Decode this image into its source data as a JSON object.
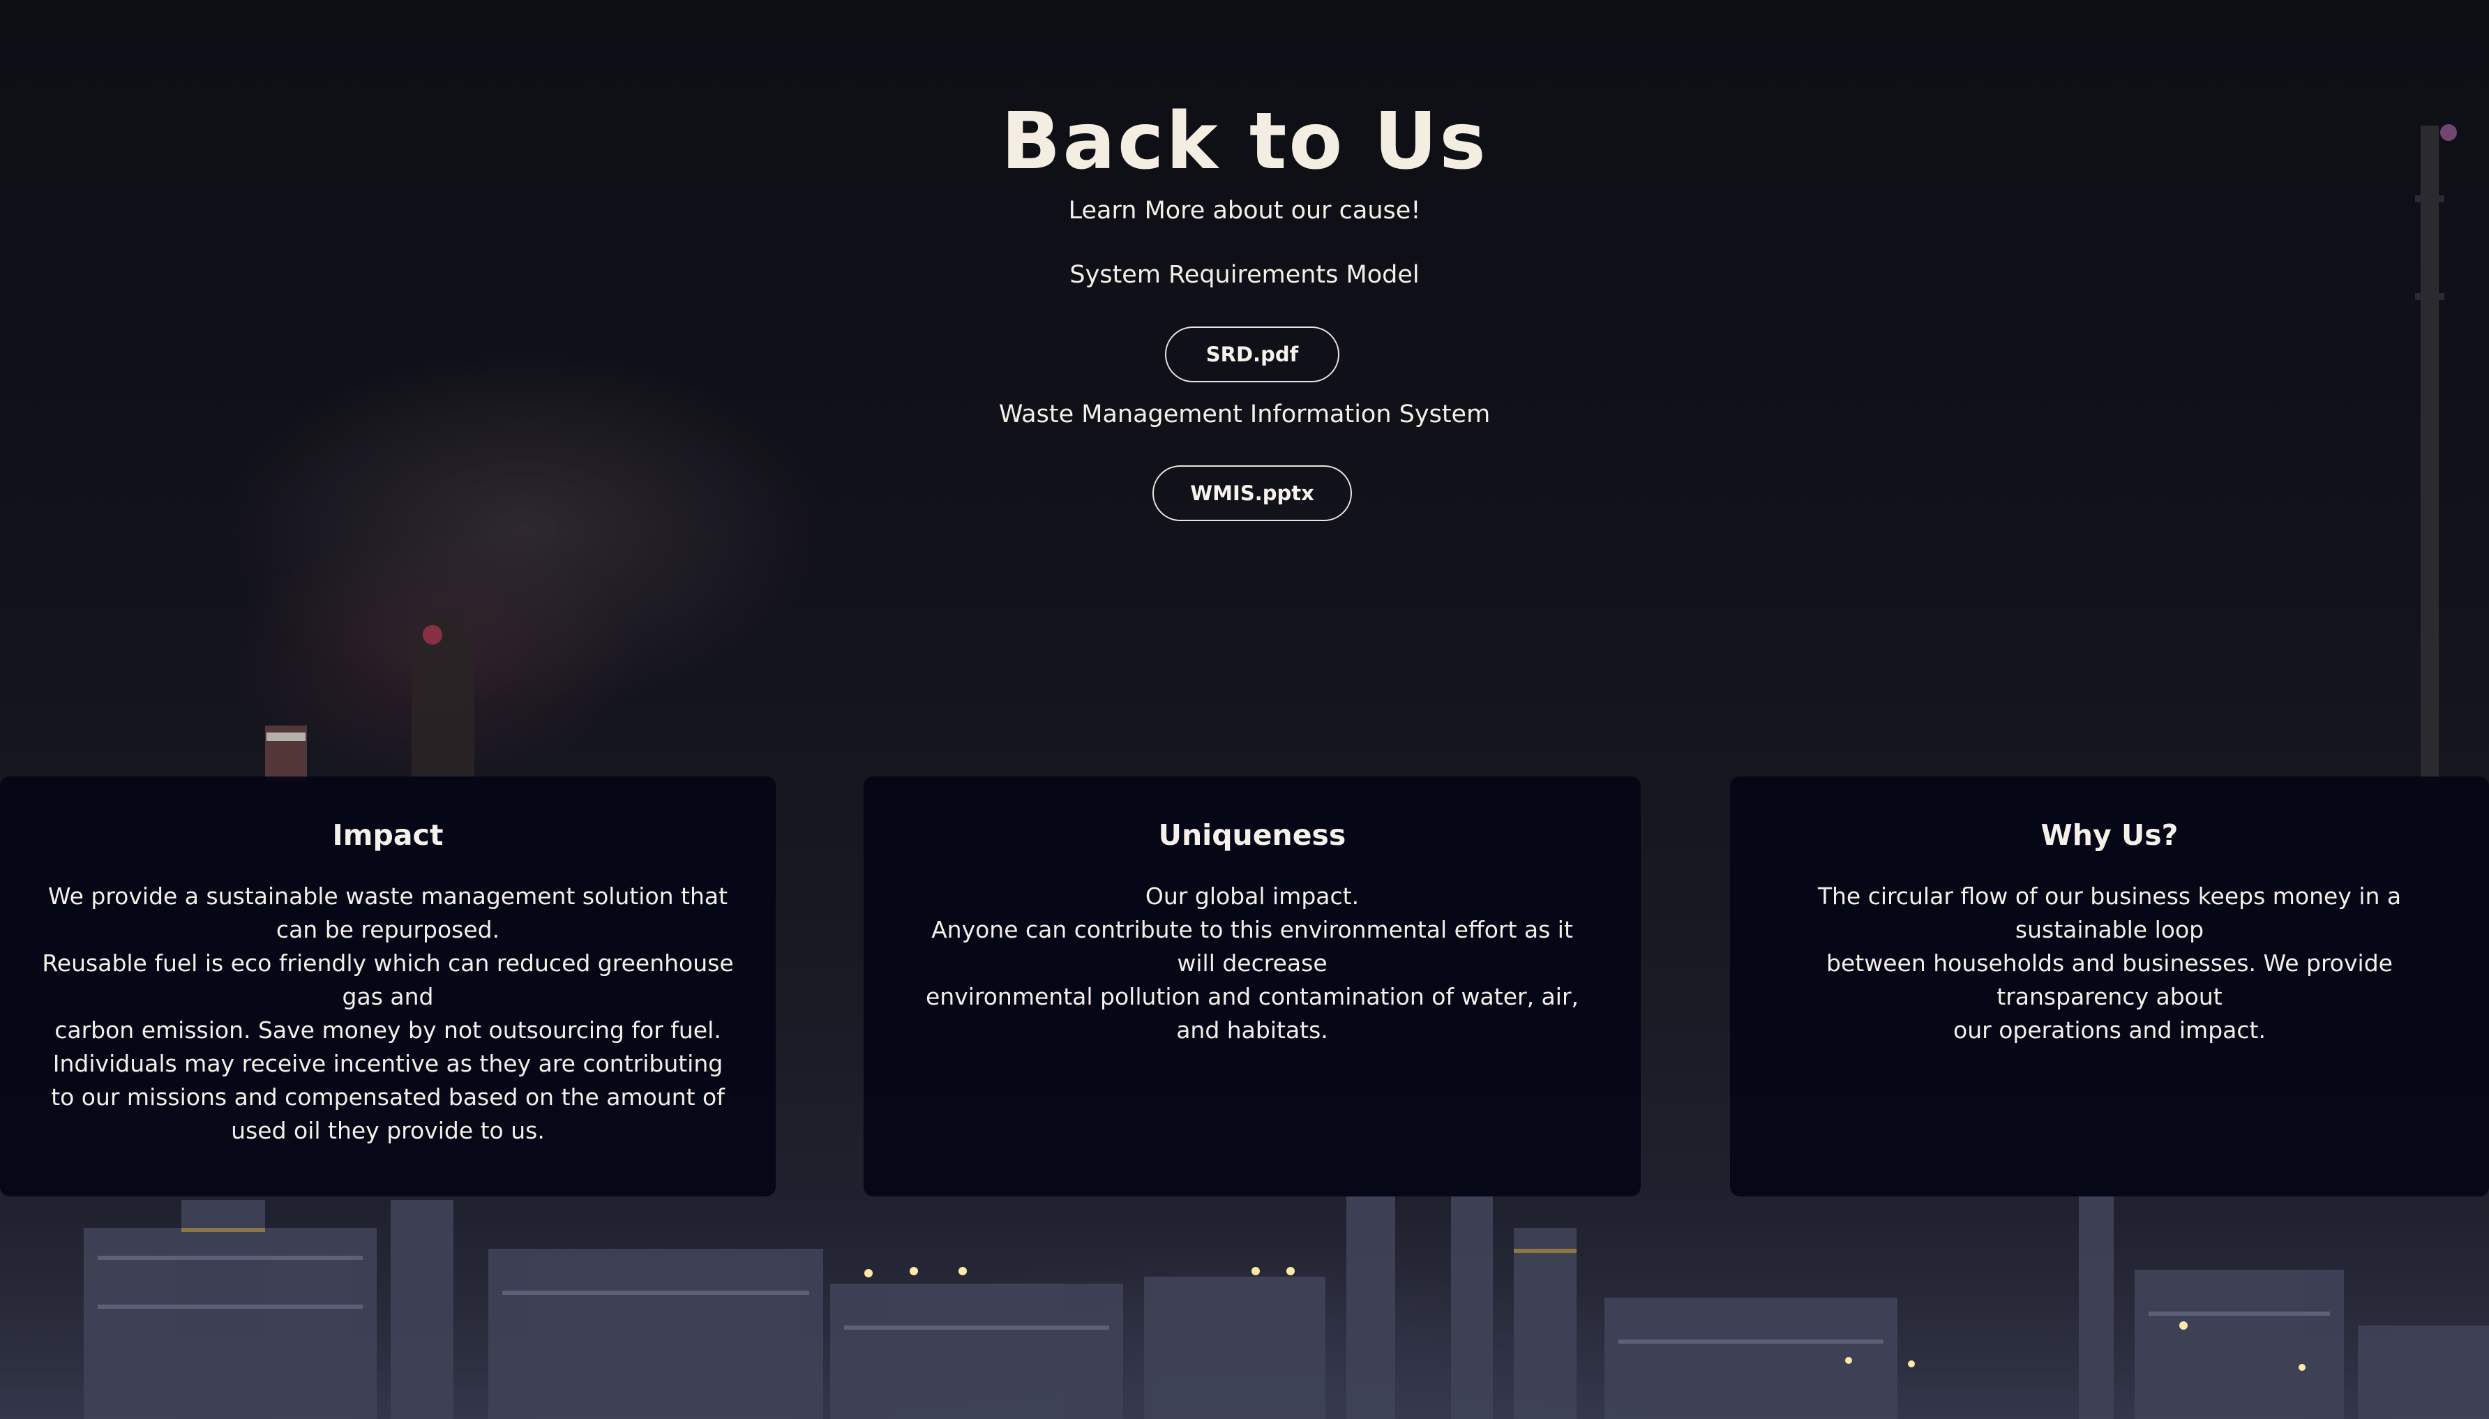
{
  "hero": {
    "title": "Back to Us",
    "subtitle": "Learn More about our cause!",
    "section1_label": "System Requirements Model",
    "section1_button": "SRD.pdf",
    "section2_label": "Waste Management Information System",
    "section2_button": "WMIS.pptx"
  },
  "cards": [
    {
      "title": "Impact",
      "lines": [
        "We provide a sustainable waste management solution that can be repurposed.",
        "Reusable fuel is eco friendly which can reduced greenhouse gas and",
        "carbon emission. Save money by not outsourcing for fuel.",
        "Individuals may receive incentive as they are contributing to our missions and compensated based on the amount of used oil they provide to us."
      ]
    },
    {
      "title": "Uniqueness",
      "lines": [
        "Our global impact.",
        "Anyone can contribute to this environmental effort as it will decrease",
        "environmental pollution and contamination of water, air, and habitats."
      ]
    },
    {
      "title": "Why Us?",
      "lines": [
        "The circular flow of our business keeps money in a sustainable loop",
        "between households and businesses. We provide transparency about",
        "our operations and impact."
      ]
    }
  ],
  "colors": {
    "background": "#0b0d14",
    "card_background": "#04051a",
    "text": "#f4ede2"
  }
}
